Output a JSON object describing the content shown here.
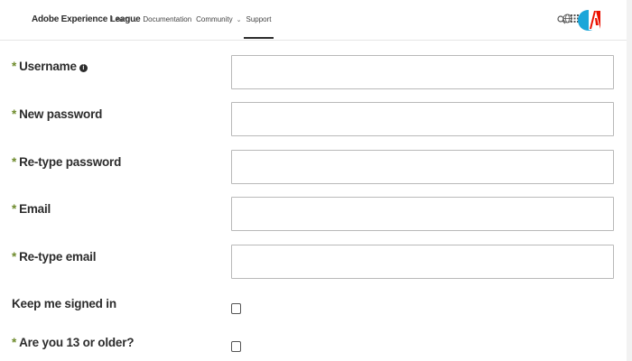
{
  "header": {
    "brand": "Adobe Experience League",
    "nav": [
      {
        "label": "Learn",
        "has_menu": true
      },
      {
        "label": "Documentation",
        "has_menu": false
      },
      {
        "label": "Community",
        "has_menu": true
      },
      {
        "label": "Support",
        "has_menu": false,
        "active": true
      }
    ],
    "icons": [
      "search-icon",
      "globe-icon",
      "apps-grid-icon",
      "avatar",
      "adobe-logo"
    ],
    "colors": {
      "avatar": "#1ba6d9",
      "adobe_red": "#eb1000"
    }
  },
  "form": {
    "required_marker": "*",
    "required_color": "#6e8b2c",
    "fields": [
      {
        "label": "Username",
        "required": true,
        "info_icon": true,
        "value": ""
      },
      {
        "label": "New password",
        "required": true,
        "value": ""
      },
      {
        "label": "Re-type password",
        "required": true,
        "value": ""
      },
      {
        "label": "Email",
        "required": true,
        "value": ""
      },
      {
        "label": "Re-type email",
        "required": true,
        "value": ""
      }
    ],
    "checkboxes": [
      {
        "label": "Keep me signed in",
        "required": false,
        "checked": false
      },
      {
        "label": "Are you 13 or older?",
        "required": true,
        "checked": false
      }
    ]
  }
}
